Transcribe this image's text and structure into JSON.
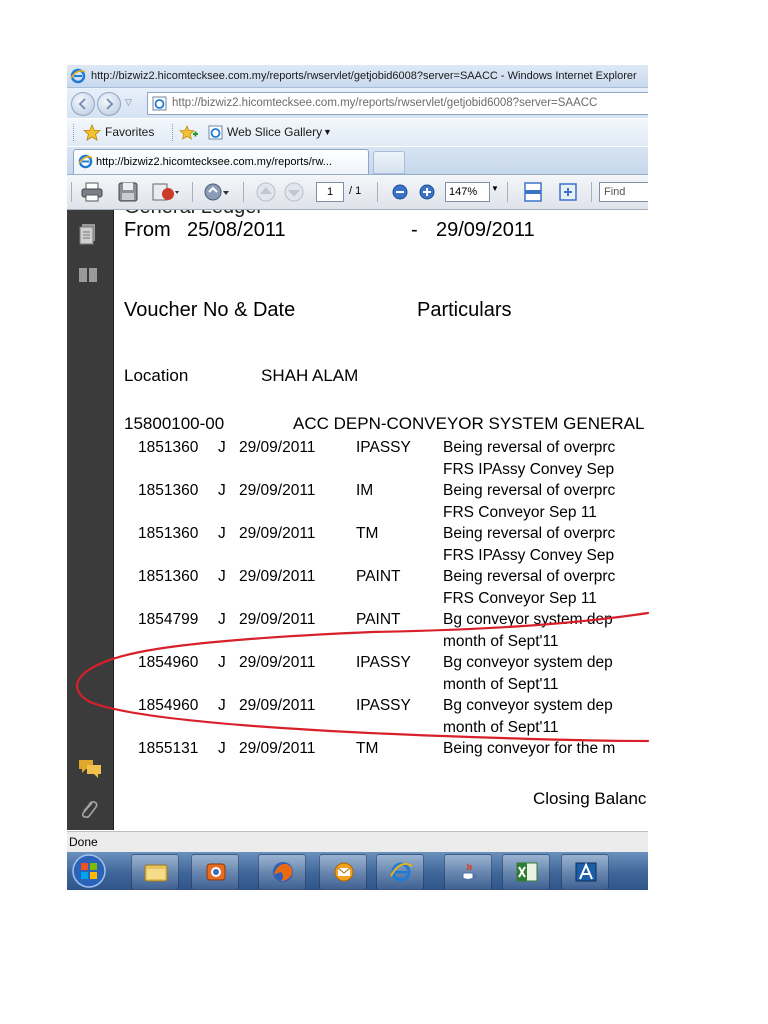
{
  "browser": {
    "title": "http://bizwiz2.hicomtecksee.com.my/reports/rwservlet/getjobid6008?server=SAACC - Windows Internet Explorer",
    "address": "http://bizwiz2.hicomtecksee.com.my/reports/rwservlet/getjobid6008?server=SAACC",
    "favorites_label": "Favorites",
    "web_slice_label": "Web Slice Gallery",
    "tab_label": "http://bizwiz2.hicomtecksee.com.my/reports/rw..."
  },
  "pdf_toolbar": {
    "page_current": "1",
    "page_total": "/ 1",
    "zoom": "147%",
    "find_placeholder": "Find"
  },
  "report": {
    "title_cut": "General Ledger",
    "from_label": "From",
    "from_date": "25/08/2011",
    "dash": "-",
    "to_date": "29/09/2011",
    "col_voucher": "Voucher No & Date",
    "col_particulars": "Particulars",
    "location_label": "Location",
    "location_value": "SHAH ALAM",
    "account_code": "15800100-00",
    "account_name": "ACC DEPN-CONVEYOR SYSTEM GENERAL",
    "rows": [
      {
        "voucher": "1851360",
        "type": "J",
        "date": "29/09/2011",
        "dept": "IPASSY",
        "desc1": "Being reversal of overprc",
        "desc2": "FRS IPAssy Convey Sep"
      },
      {
        "voucher": "1851360",
        "type": "J",
        "date": "29/09/2011",
        "dept": "IM",
        "desc1": "Being reversal of overprc",
        "desc2": "FRS Conveyor Sep 11"
      },
      {
        "voucher": "1851360",
        "type": "J",
        "date": "29/09/2011",
        "dept": "TM",
        "desc1": "Being reversal of overprc",
        "desc2": "FRS IPAssy Convey Sep"
      },
      {
        "voucher": "1851360",
        "type": "J",
        "date": "29/09/2011",
        "dept": "PAINT",
        "desc1": "Being reversal of overprc",
        "desc2": "FRS Conveyor Sep 11"
      },
      {
        "voucher": "1854799",
        "type": "J",
        "date": "29/09/2011",
        "dept": "PAINT",
        "desc1": "Bg conveyor system dep",
        "desc2": "month of Sept'11"
      },
      {
        "voucher": "1854960",
        "type": "J",
        "date": "29/09/2011",
        "dept": "IPASSY",
        "desc1": "Bg conveyor system dep",
        "desc2": "month of Sept'11"
      },
      {
        "voucher": "1854960",
        "type": "J",
        "date": "29/09/2011",
        "dept": "IPASSY",
        "desc1": "Bg conveyor system dep",
        "desc2": "month of Sept'11"
      },
      {
        "voucher": "1855131",
        "type": "J",
        "date": "29/09/2011",
        "dept": "TM",
        "desc1": "Being conveyor for the m",
        "desc2": ""
      }
    ],
    "closing_balance": "Closing Balanc"
  },
  "status": {
    "text": "Done"
  },
  "taskbar": {
    "items": [
      "start-orb",
      "explorer-icon",
      "media-icon",
      "firefox-icon",
      "outlook-icon",
      "ie-icon",
      "java-icon",
      "excel-icon",
      "autocad-icon"
    ]
  },
  "colors": {
    "annotation": "#d8202a",
    "leftpane": "#3b3b3b",
    "taskbar": "#3f6699"
  }
}
